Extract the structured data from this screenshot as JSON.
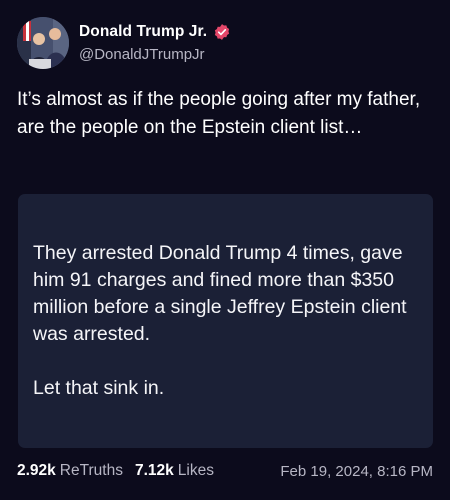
{
  "post": {
    "author_name": "Donald Trump Jr.",
    "author_handle": "@DonaldJTrumpJr",
    "text": "It’s almost as if the people going after my father, are the people on the Epstein client list…",
    "quote": {
      "text": "They arrested Donald Trump 4 times, gave him 91 charges and fined more than $350 million before a single Jeffrey Epstein client was arrested.",
      "closing": "Let that sink in."
    },
    "stats": {
      "retruths_count": "2.92k",
      "retruths_label": "ReTruths",
      "likes_count": "7.12k",
      "likes_label": "Likes"
    },
    "timestamp": "Feb 19, 2024, 8:16 PM"
  },
  "colors": {
    "background": "#0c0b1c",
    "card": "#1b2036",
    "verified_badge": "#e4476a",
    "muted_text": "#b7b6c4"
  },
  "icons": {
    "verified": "verified-badge-icon"
  }
}
